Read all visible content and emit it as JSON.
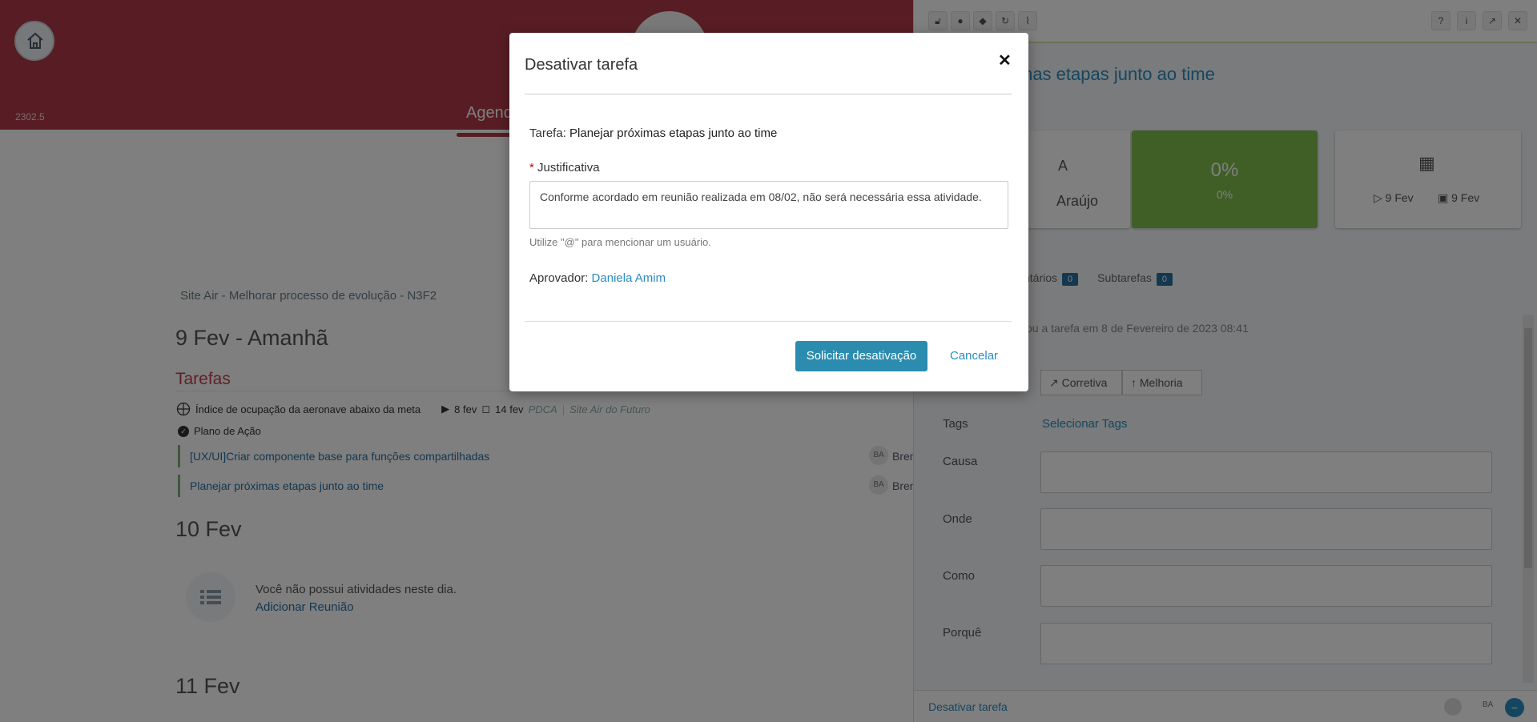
{
  "header": {
    "version": "2302.5",
    "agenda_tab": "Agenda"
  },
  "agenda": {
    "breadcrumb": "Site Air - Melhorar processo de evolução - N3F2",
    "day1_title": "9 Fev - Amanhã",
    "tarefas_label": "Tarefas",
    "task": {
      "name": "Índice de ocupação da aeronave abaixo da meta",
      "start": "8 fev",
      "end": "14 fev",
      "method": "PDCA",
      "project": "Site Air do Futuro"
    },
    "plano_label": "Plano de Ação",
    "subtasks": [
      {
        "label": "[UX/UI]Criar componente base para funções compartilhadas",
        "initials": "BA",
        "owner": "Bren"
      },
      {
        "label": "Planejar próximas etapas junto ao time",
        "initials": "BA",
        "owner": "Bren"
      }
    ],
    "day2_title": "10 Fev",
    "empty_text": "Você não possui atividades neste dia.",
    "add_meeting": "Adicionar Reunião",
    "day3_title": "11 Fev"
  },
  "panel": {
    "title_fragment": "mas etapas junto ao time",
    "owner_initial": "A",
    "owner_name": "Araújo",
    "pct_main": "0%",
    "pct_sub": "0%",
    "date_start": "9 Fev",
    "date_end": "9 Fev",
    "tab_comments": "ntários",
    "comments_count": "0",
    "tab_subtasks": "Subtarefas",
    "subtasks_count": "0",
    "activity": "ou a tarefa em 8 de Fevereiro de 2023 08:41",
    "seg_corretiva": "Corretiva",
    "seg_melhoria": "Melhoria",
    "tags_label": "Tags",
    "tags_link": "Selecionar Tags",
    "fields": [
      "Causa",
      "Onde",
      "Como",
      "Porquê"
    ],
    "footer_text": "Desativar tarefa",
    "footer_initials": "BA"
  },
  "modal": {
    "title": "Desativar tarefa",
    "tarefa_prefix": "Tarefa:",
    "tarefa_name": "Planejar próximas etapas junto ao time",
    "justificativa_label": "Justificativa",
    "justificativa_value": "Conforme acordado em reunião realizada em 08/02, não será necessária essa atividade.",
    "hint": "Utilize \"@\" para mencionar um usuário.",
    "aprovador_prefix": "Aprovador:",
    "aprovador_name": "Daniela Amim",
    "submit_label": "Solicitar desativação",
    "cancel_label": "Cancelar"
  }
}
